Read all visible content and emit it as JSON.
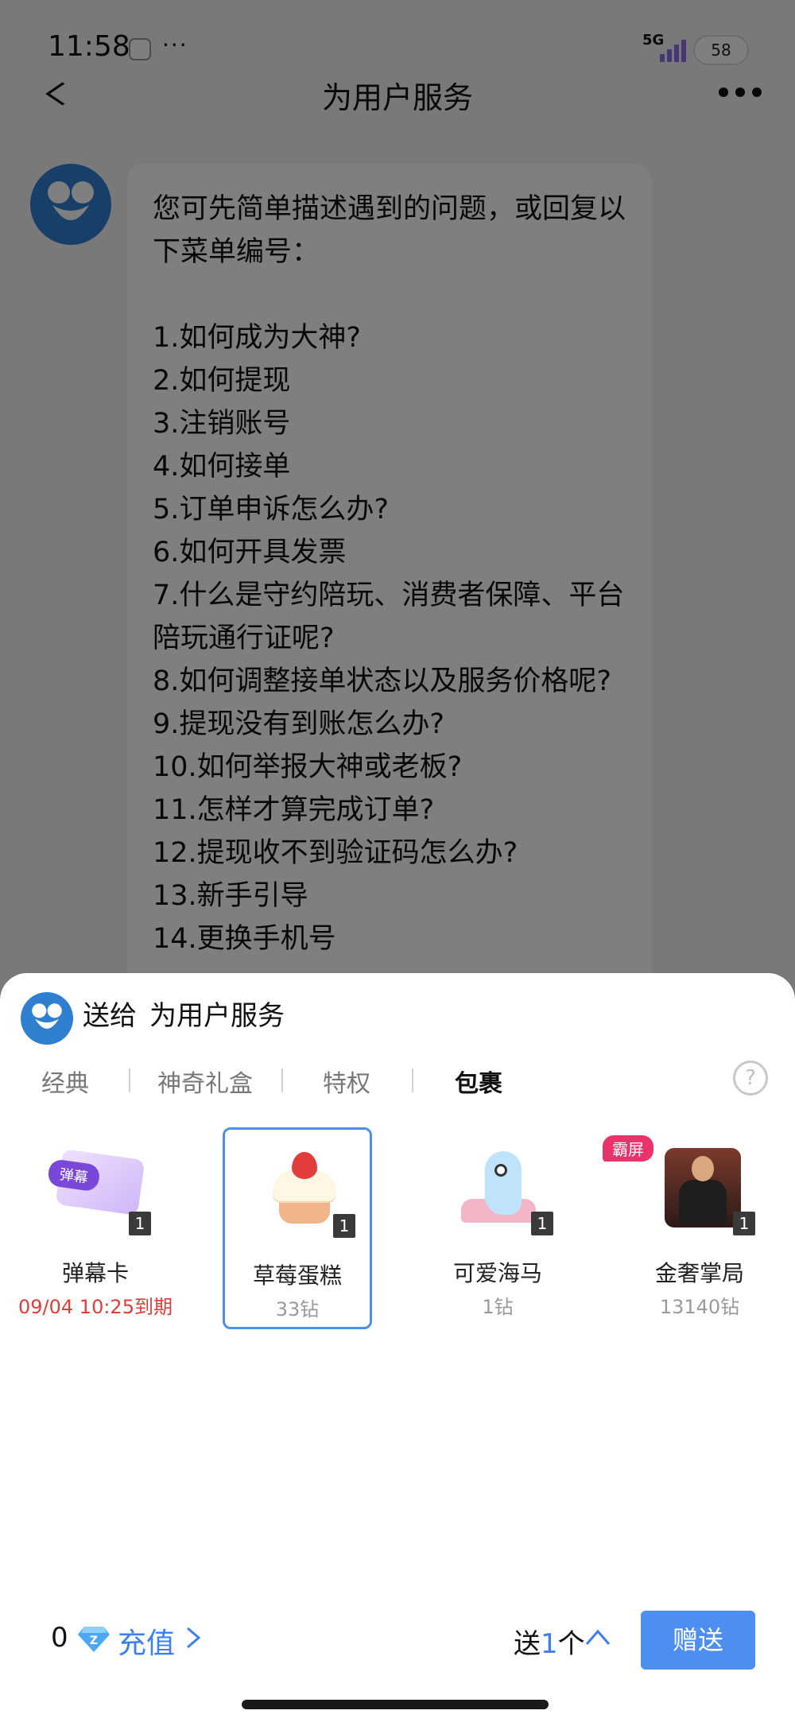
{
  "status_bar": {
    "time": "11:58",
    "dots": "···",
    "network": "5G",
    "battery": "58"
  },
  "nav": {
    "title": "为用户服务"
  },
  "chat": {
    "intro": "您可先简单描述遇到的问题，或回复以下菜单编号：",
    "items": [
      "1.如何成为大神?",
      "2.如何提现",
      "3.注销账号",
      "4.如何接单",
      "5.订单申诉怎么办?",
      "6.如何开具发票",
      "7.什么是守约陪玩、消费者保障、平台陪玩通行证呢?",
      "8.如何调整接单状态以及服务价格呢?",
      "9.提现没有到账怎么办?",
      "10.如何举报大神或老板?",
      "11.怎样才算完成订单?",
      "12.提现收不到验证码怎么办?",
      "13.新手引导",
      "14.更换手机号"
    ]
  },
  "sheet": {
    "prefix": "送给",
    "recipient": "为用户服务",
    "tabs": [
      "经典",
      "神奇礼盒",
      "特权",
      "包裹"
    ],
    "active_tab": "包裹",
    "help": "?",
    "gifts": [
      {
        "name": "弹幕卡",
        "sub": "09/04 10:25到期",
        "count": "1",
        "tag": "弹幕",
        "icon": "danmaku-card-icon"
      },
      {
        "name": "草莓蛋糕",
        "sub": "33钻",
        "count": "1",
        "icon": "strawberry-cake-icon",
        "selected": true
      },
      {
        "name": "可爱海马",
        "sub": "1钻",
        "count": "1",
        "icon": "seahorse-icon"
      },
      {
        "name": "金奢掌局",
        "sub": "13140钻",
        "count": "1",
        "badge": "霸屏",
        "icon": "luxury-figure-icon"
      }
    ],
    "balance": "0",
    "recharge": "充值",
    "send_prefix": "送",
    "send_num": "1",
    "send_unit": "个",
    "send_button": "赠送"
  },
  "colors": {
    "accent": "#4c8ff0",
    "expire": "#d9403b",
    "badge": "#e8346b"
  }
}
